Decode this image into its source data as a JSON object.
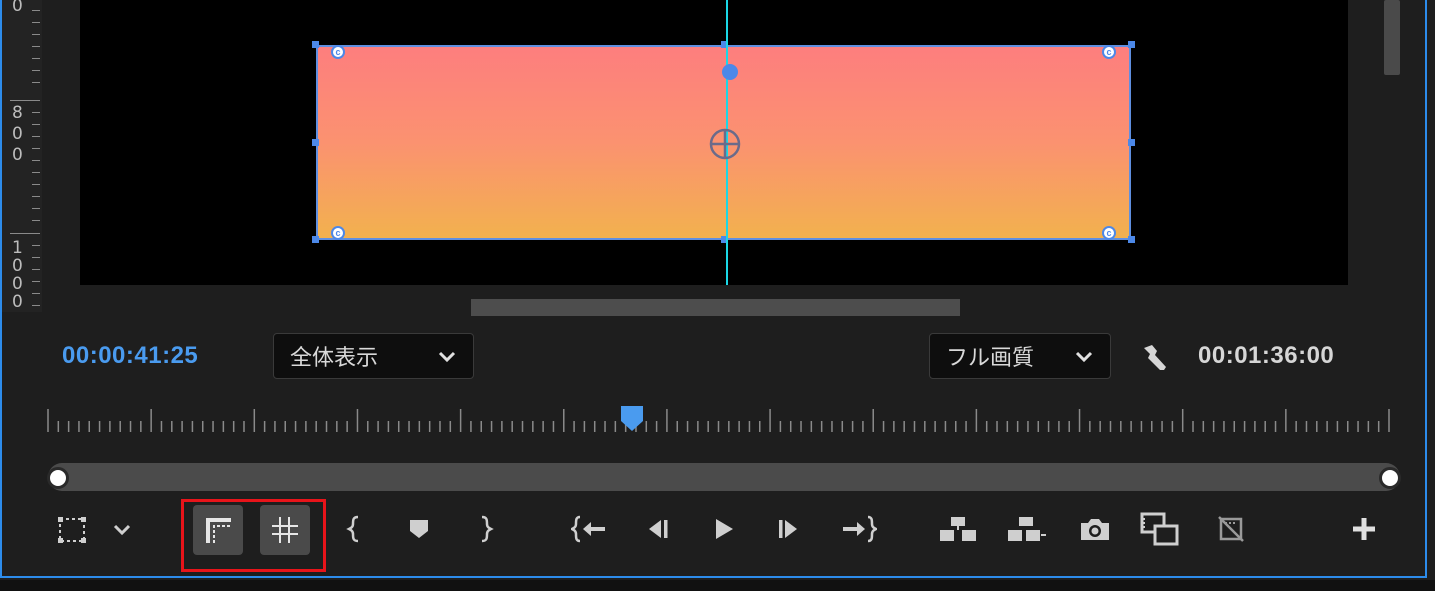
{
  "viewer": {
    "ruler_digits": [
      "0",
      "8",
      "0",
      "0",
      "1",
      "0",
      "0",
      "0"
    ]
  },
  "controls": {
    "current_time": "00:00:41:25",
    "zoom_select": "全体表示",
    "quality_select": "フル画質",
    "duration": "00:01:36:00"
  },
  "toolbar": {
    "buttons": [
      "select-zoom-level",
      "settings-dropdown",
      "safe-margins",
      "show-guides",
      "mark-in",
      "add-marker",
      "mark-out",
      "go-to-in",
      "step-back",
      "play",
      "step-forward",
      "go-to-out",
      "lift",
      "extract",
      "export-frame",
      "comparison-view",
      "toggle-proxies",
      "button-editor"
    ],
    "highlighted": [
      "safe-margins",
      "show-guides"
    ]
  },
  "colors": {
    "accent_blue": "#4a9bef",
    "guide_cyan": "#1ad7e6",
    "highlight_red": "#e8141a",
    "gradient_top": "#fd7e7e",
    "gradient_bottom": "#f2b14e"
  }
}
